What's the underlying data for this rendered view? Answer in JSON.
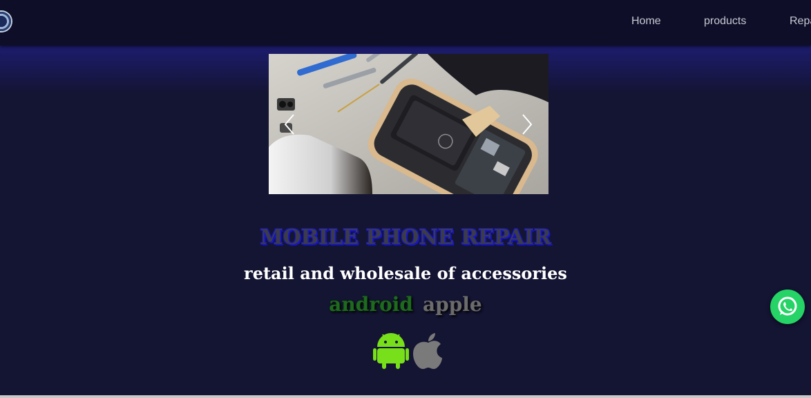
{
  "nav": {
    "links": [
      "Home",
      "products",
      "Repa"
    ]
  },
  "hero": {
    "title": "MOBILE PHONE REPAIR",
    "subtitle": "retail and wholesale of accessories",
    "brand_android": "android",
    "brand_apple": "apple"
  },
  "icons": {
    "logo": "logo-icon",
    "prev": "chevron-left-icon",
    "next": "chevron-right-icon",
    "android": "android-icon",
    "apple": "apple-icon",
    "whatsapp": "whatsapp-icon"
  },
  "colors": {
    "page_background": "#141433",
    "navbar": "#0e0e29",
    "whatsapp": "#25d366",
    "android_icon": "#78e01a",
    "apple_icon": "#7a7a7a"
  }
}
